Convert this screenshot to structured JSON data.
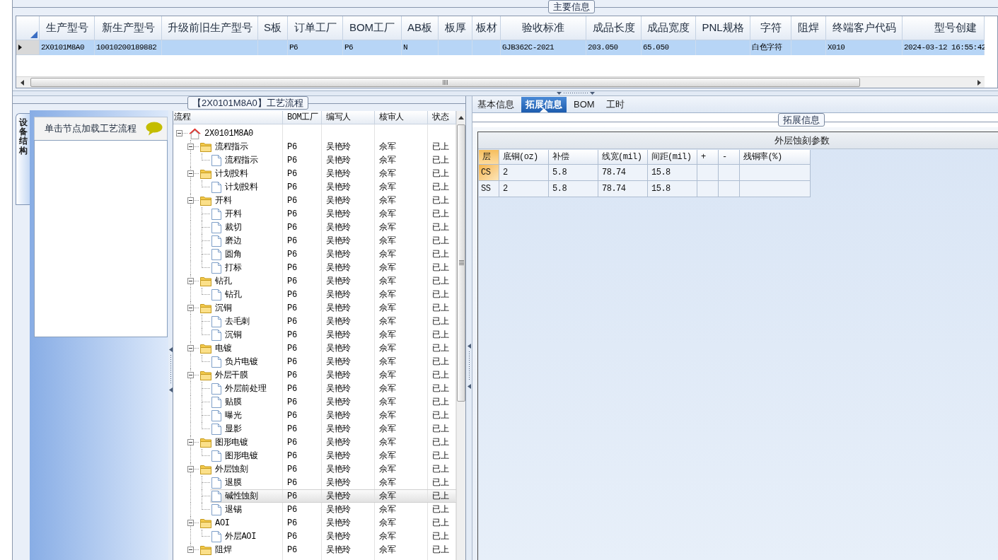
{
  "main_info": {
    "title": "主要信息",
    "columns": [
      "生产型号",
      "新生产型号",
      "升级前旧生产型号",
      "S板",
      "订单工厂",
      "BOM工厂",
      "AB板",
      "板厚",
      "板材",
      "验收标准",
      "成品长度",
      "成品宽度",
      "PNL规格",
      "字符",
      "阻焊",
      "终端客户代码",
      "型号创建"
    ],
    "rows": [
      {
        "selected": true,
        "cells": [
          "2X0101M8A0",
          "10010200189882",
          null,
          null,
          "P6",
          "P6",
          "N",
          null,
          null,
          "GJB362C-2021",
          "203.050",
          "65.050",
          null,
          "白色字符",
          null,
          "X010",
          "2024-03-12 16:55:42"
        ]
      }
    ]
  },
  "process_flow": {
    "title": "【2X0101M8A0】工艺流程",
    "side_tab": {
      "label": "设备结构",
      "selected": true
    },
    "hint": "单击节点加载工艺流程",
    "tree": {
      "columns": [
        "流程",
        "BOM工厂",
        "编写人",
        "核审人",
        "状态"
      ],
      "nodes": [
        {
          "label": "2X0101M8A0",
          "expanded": true,
          "selected": false,
          "children": [
            {
              "label": "流程指示",
              "bom": "P6",
              "writer": "吴艳玲",
              "reviewer": "佘军",
              "status": "已上",
              "expanded": true,
              "selected": false,
              "children": [
                {
                  "label": "流程指示",
                  "bom": "P6",
                  "writer": "吴艳玲",
                  "reviewer": "佘军",
                  "status": "已上",
                  "selected": false
                }
              ]
            },
            {
              "label": "计划投料",
              "bom": "P6",
              "writer": "吴艳玲",
              "reviewer": "佘军",
              "status": "已上",
              "expanded": true,
              "selected": false,
              "children": [
                {
                  "label": "计划投料",
                  "bom": "P6",
                  "writer": "吴艳玲",
                  "reviewer": "佘军",
                  "status": "已上",
                  "selected": false
                }
              ]
            },
            {
              "label": "开料",
              "bom": "P6",
              "writer": "吴艳玲",
              "reviewer": "佘军",
              "status": "已上",
              "expanded": true,
              "selected": false,
              "children": [
                {
                  "label": "开料",
                  "bom": "P6",
                  "writer": "吴艳玲",
                  "reviewer": "佘军",
                  "status": "已上",
                  "selected": false
                },
                {
                  "label": "裁切",
                  "bom": "P6",
                  "writer": "吴艳玲",
                  "reviewer": "佘军",
                  "status": "已上",
                  "selected": false
                },
                {
                  "label": "磨边",
                  "bom": "P6",
                  "writer": "吴艳玲",
                  "reviewer": "佘军",
                  "status": "已上",
                  "selected": false
                },
                {
                  "label": "圆角",
                  "bom": "P6",
                  "writer": "吴艳玲",
                  "reviewer": "佘军",
                  "status": "已上",
                  "selected": false
                },
                {
                  "label": "打标",
                  "bom": "P6",
                  "writer": "吴艳玲",
                  "reviewer": "佘军",
                  "status": "已上",
                  "selected": false
                }
              ]
            },
            {
              "label": "钻孔",
              "bom": "P6",
              "writer": "吴艳玲",
              "reviewer": "佘军",
              "status": "已上",
              "expanded": true,
              "selected": false,
              "children": [
                {
                  "label": "钻孔",
                  "bom": "P6",
                  "writer": "吴艳玲",
                  "reviewer": "佘军",
                  "status": "已上",
                  "selected": false
                }
              ]
            },
            {
              "label": "沉铜",
              "bom": "P6",
              "writer": "吴艳玲",
              "reviewer": "佘军",
              "status": "已上",
              "expanded": true,
              "selected": false,
              "children": [
                {
                  "label": "去毛刺",
                  "bom": "P6",
                  "writer": "吴艳玲",
                  "reviewer": "佘军",
                  "status": "已上",
                  "selected": false
                },
                {
                  "label": "沉铜",
                  "bom": "P6",
                  "writer": "吴艳玲",
                  "reviewer": "佘军",
                  "status": "已上",
                  "selected": false
                }
              ]
            },
            {
              "label": "电镀",
              "bom": "P6",
              "writer": "吴艳玲",
              "reviewer": "佘军",
              "status": "已上",
              "expanded": true,
              "selected": false,
              "children": [
                {
                  "label": "负片电镀",
                  "bom": "P6",
                  "writer": "吴艳玲",
                  "reviewer": "佘军",
                  "status": "已上",
                  "selected": false
                }
              ]
            },
            {
              "label": "外层干膜",
              "bom": "P6",
              "writer": "吴艳玲",
              "reviewer": "佘军",
              "status": "已上",
              "expanded": true,
              "selected": false,
              "children": [
                {
                  "label": "外层前处理",
                  "bom": "P6",
                  "writer": "吴艳玲",
                  "reviewer": "佘军",
                  "status": "已上",
                  "selected": false
                },
                {
                  "label": "贴膜",
                  "bom": "P6",
                  "writer": "吴艳玲",
                  "reviewer": "佘军",
                  "status": "已上",
                  "selected": false
                },
                {
                  "label": "曝光",
                  "bom": "P6",
                  "writer": "吴艳玲",
                  "reviewer": "佘军",
                  "status": "已上",
                  "selected": false
                },
                {
                  "label": "显影",
                  "bom": "P6",
                  "writer": "吴艳玲",
                  "reviewer": "佘军",
                  "status": "已上",
                  "selected": false
                }
              ]
            },
            {
              "label": "图形电镀",
              "bom": "P6",
              "writer": "吴艳玲",
              "reviewer": "佘军",
              "status": "已上",
              "expanded": true,
              "selected": false,
              "children": [
                {
                  "label": "图形电镀",
                  "bom": "P6",
                  "writer": "吴艳玲",
                  "reviewer": "佘军",
                  "status": "已上",
                  "selected": false
                }
              ]
            },
            {
              "label": "外层蚀刻",
              "bom": "P6",
              "writer": "吴艳玲",
              "reviewer": "佘军",
              "status": "已上",
              "expanded": true,
              "selected": false,
              "children": [
                {
                  "label": "退膜",
                  "bom": "P6",
                  "writer": "吴艳玲",
                  "reviewer": "佘军",
                  "status": "已上",
                  "selected": false
                },
                {
                  "label": "碱性蚀刻",
                  "bom": "P6",
                  "writer": "吴艳玲",
                  "reviewer": "佘军",
                  "status": "已上",
                  "selected": true
                },
                {
                  "label": "退锡",
                  "bom": "P6",
                  "writer": "吴艳玲",
                  "reviewer": "佘军",
                  "status": "已上",
                  "selected": false
                }
              ]
            },
            {
              "label": "AOI",
              "bom": "P6",
              "writer": "吴艳玲",
              "reviewer": "佘军",
              "status": "已上",
              "expanded": true,
              "selected": false,
              "children": [
                {
                  "label": "外层AOI",
                  "bom": "P6",
                  "writer": "吴艳玲",
                  "reviewer": "佘军",
                  "status": "已上",
                  "selected": false
                }
              ]
            },
            {
              "label": "阻焊",
              "bom": "P6",
              "writer": "吴艳玲",
              "reviewer": "佘军",
              "status": "已上",
              "expanded": true,
              "selected": false
            }
          ]
        }
      ]
    }
  },
  "details": {
    "tabs": [
      {
        "label": "基本信息",
        "selected": false
      },
      {
        "label": "拓展信息",
        "selected": true
      },
      {
        "label": "BOM",
        "selected": false
      },
      {
        "label": "工时",
        "selected": false
      }
    ],
    "group_title": "拓展信息",
    "etch_table": {
      "title": "外层蚀刻参数",
      "columns": [
        "层",
        "底铜(oz)",
        "补偿",
        "线宽(mil)",
        "间距(mil)",
        "+",
        "-",
        "残铜率(%)"
      ],
      "rows": [
        {
          "selected": true,
          "cells": [
            "CS",
            "2",
            "5.8",
            "78.74",
            "15.8",
            null,
            null,
            null
          ]
        },
        {
          "selected": false,
          "cells": [
            "SS",
            "2",
            "5.8",
            "78.74",
            "15.8",
            null,
            null,
            null
          ]
        }
      ]
    }
  }
}
